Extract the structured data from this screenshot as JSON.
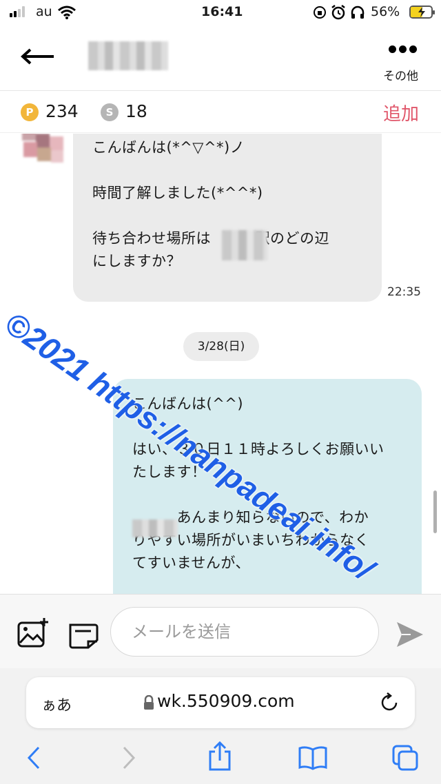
{
  "status_bar": {
    "carrier": "au",
    "time": "16:41",
    "battery_percent": "56%",
    "battery_level": 0.56
  },
  "header": {
    "contact_name": "",
    "more_label": "その他"
  },
  "points": {
    "p_label": "P",
    "p_value": "234",
    "s_label": "S",
    "s_value": "18",
    "add_label": "追加"
  },
  "messages": [
    {
      "side": "received",
      "lines": [
        "こんばんは(*^▽^*)ノ",
        "",
        "時間了解しました(*^^*)",
        "",
        "待ち合わせ場所は　　　駅のどの辺",
        "にしますか？"
      ],
      "time": "22:35"
    },
    {
      "side": "date",
      "label": "3/28(日)"
    },
    {
      "side": "sent",
      "lines": [
        "こんばんは(^^)",
        "",
        "はい、３０日１１時よろしくお願いい",
        "たします！",
        "",
        "　　　あんまり知らないので、わか",
        "りやすい場所がいまいちわからなく",
        "てすいませんが、"
      ]
    }
  ],
  "watermark": "©2021 https://nanpadeai.info/",
  "compose": {
    "placeholder": "メールを送信"
  },
  "browser": {
    "text_size_label": "ぁあ",
    "url": "wk.550909.com"
  },
  "colors": {
    "received_bubble": "#ebebeb",
    "sent_bubble": "#d6ecef",
    "add_red": "#e0566a",
    "p_coin": "#f2b63a",
    "s_coin": "#b5b5b5",
    "watermark_blue": "#1f5fe6",
    "browser_blue": "#2f7df6"
  }
}
